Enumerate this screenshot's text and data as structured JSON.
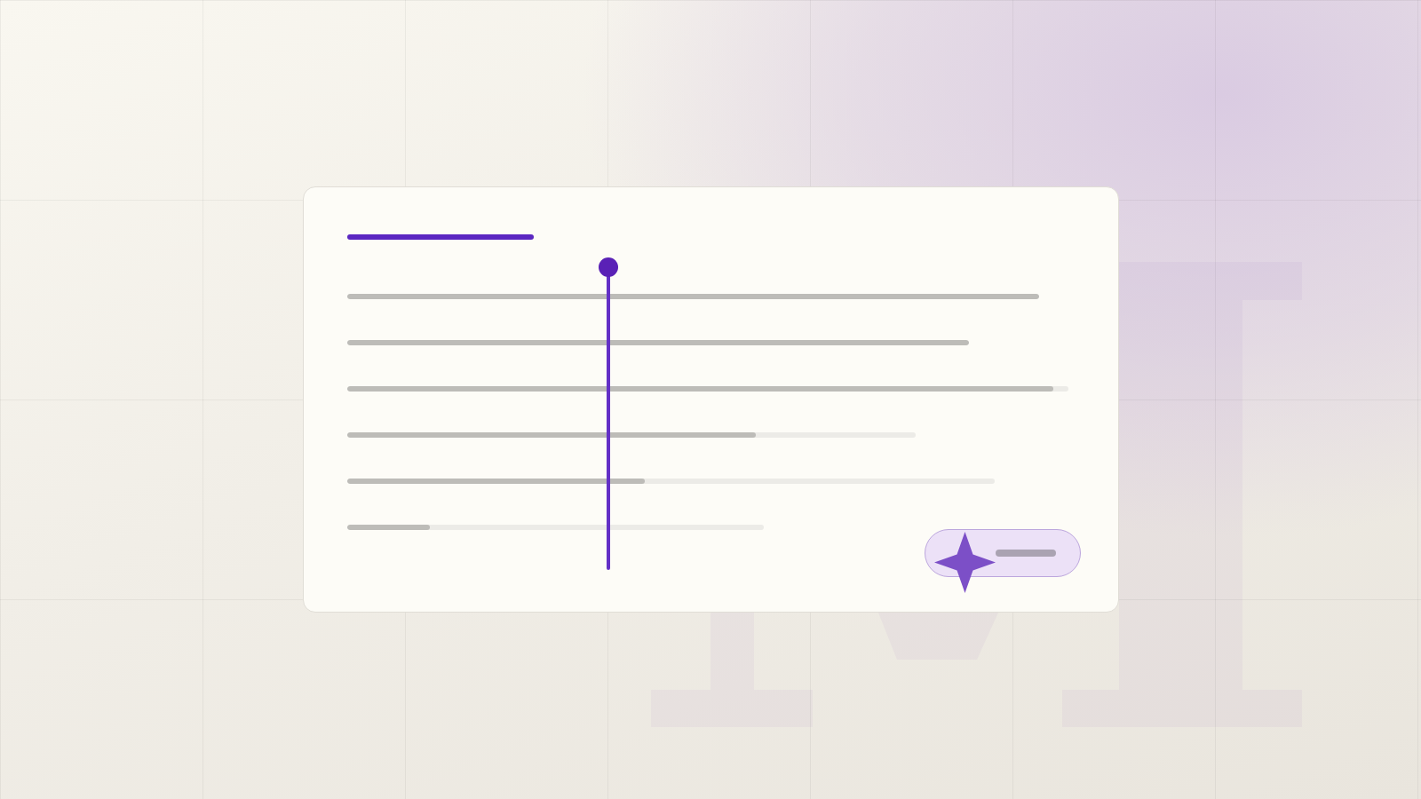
{
  "card": {
    "lines": [
      {
        "level": 1
      },
      {
        "level": 1
      },
      {
        "level": 0.98
      },
      {
        "level": 0.72
      },
      {
        "level": 0.46
      },
      {
        "level": 0.2
      }
    ]
  }
}
